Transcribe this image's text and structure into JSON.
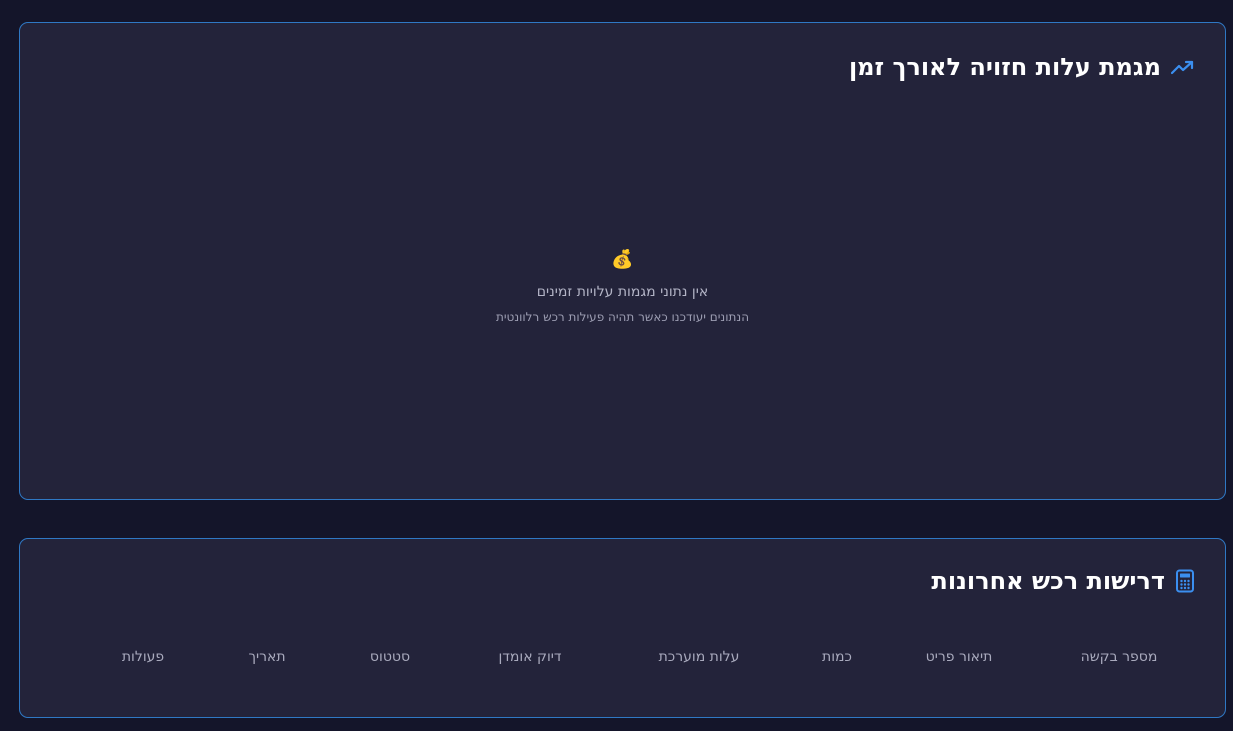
{
  "trend_panel": {
    "title": "מגמת עלות חזויה לאורך זמן",
    "icon": "trending-up-icon",
    "empty_state": {
      "icon": "money-bag-icon",
      "emoji": "💰",
      "title": "אין נתוני מגמות עלויות זמינים",
      "subtitle": "הנתונים יעודכנו כאשר תהיה פעילות רכש רלוונטית"
    }
  },
  "requests_panel": {
    "title": "דרישות רכש אחרונות",
    "icon": "calculator-icon",
    "columns": [
      "מספר בקשה",
      "תיאור פריט",
      "כמות",
      "עלות מוערכת",
      "דיוק אומדן",
      "סטטוס",
      "תאריך",
      "פעולות"
    ]
  },
  "colors": {
    "background": "#14152a",
    "panel": "#23233a",
    "border": "#2f78c4",
    "accent": "#3b8ff0"
  }
}
